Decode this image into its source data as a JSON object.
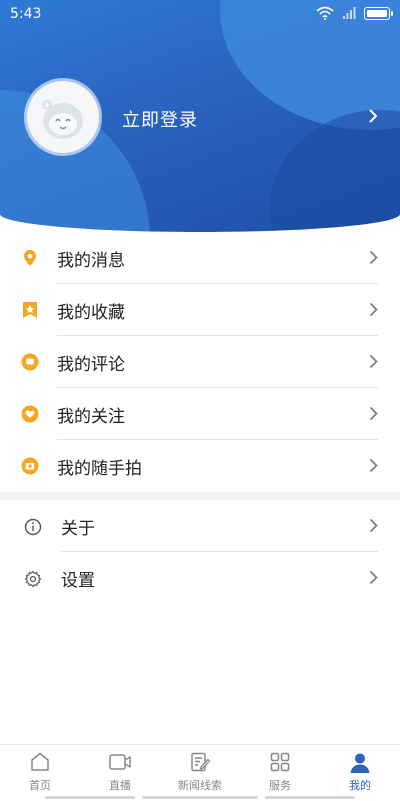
{
  "status": {
    "time": "5:43"
  },
  "profile": {
    "login_label": "立即登录"
  },
  "menu_primary": [
    {
      "label": "我的消息",
      "icon": "location-pin-icon"
    },
    {
      "label": "我的收藏",
      "icon": "bookmark-star-icon"
    },
    {
      "label": "我的评论",
      "icon": "comment-icon"
    },
    {
      "label": "我的关注",
      "icon": "heart-icon"
    },
    {
      "label": "我的随手拍",
      "icon": "camera-icon"
    }
  ],
  "menu_secondary": [
    {
      "label": "关于",
      "icon": "info-icon"
    },
    {
      "label": "设置",
      "icon": "gear-icon"
    }
  ],
  "tabs": [
    {
      "label": "首页",
      "icon": "home-icon",
      "active": false
    },
    {
      "label": "直播",
      "icon": "video-icon",
      "active": false
    },
    {
      "label": "新闻线索",
      "icon": "edit-note-icon",
      "active": false
    },
    {
      "label": "服务",
      "icon": "grid-icon",
      "active": false
    },
    {
      "label": "我的",
      "icon": "user-icon",
      "active": true
    }
  ],
  "colors": {
    "brand_blue": "#2a63c0",
    "accent_orange": "#f5a623",
    "tab_active": "#2a63c0"
  }
}
